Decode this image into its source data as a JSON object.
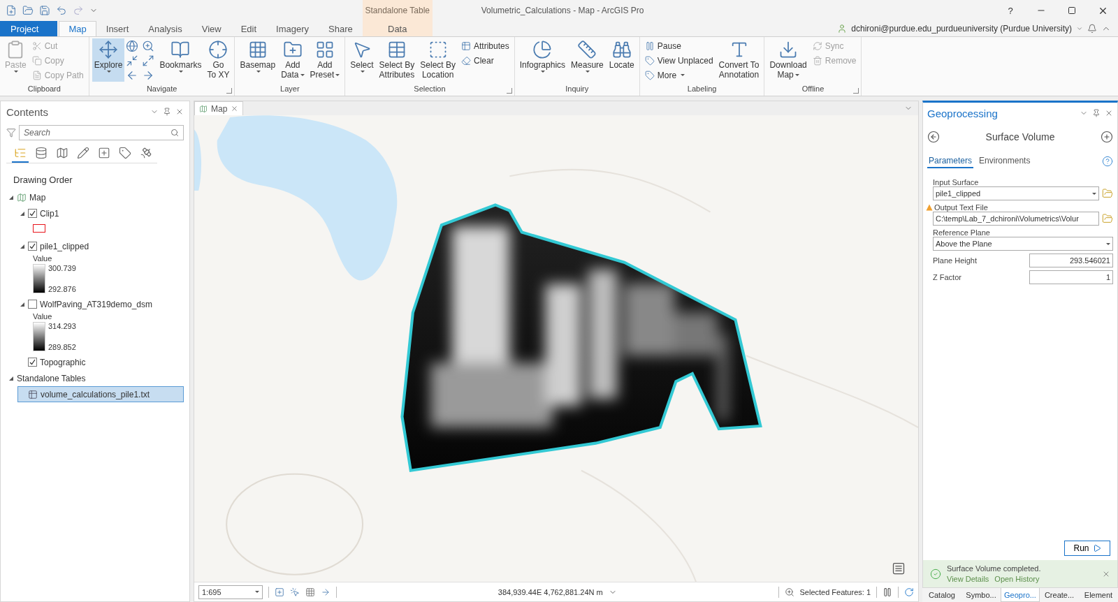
{
  "window": {
    "title": "Volumetric_Calculations - Map - ArcGIS Pro",
    "help": "?"
  },
  "contextual_tab_group": {
    "label": "Standalone Table",
    "tabs": [
      {
        "label": "Data",
        "selected": false
      }
    ]
  },
  "tabs": [
    {
      "label": "Project",
      "kind": "backstage",
      "selected": false
    },
    {
      "label": "Map",
      "kind": "tab",
      "selected": true
    },
    {
      "label": "Insert",
      "kind": "tab",
      "selected": false
    },
    {
      "label": "Analysis",
      "kind": "tab",
      "selected": false
    },
    {
      "label": "View",
      "kind": "tab",
      "selected": false
    },
    {
      "label": "Edit",
      "kind": "tab",
      "selected": false
    },
    {
      "label": "Imagery",
      "kind": "tab",
      "selected": false
    },
    {
      "label": "Share",
      "kind": "tab",
      "selected": false
    }
  ],
  "user": {
    "name": "dchironi@purdue.edu_purdueuniversity (Purdue University)"
  },
  "ribbon": {
    "groups": [
      {
        "label": "Clipboard",
        "launcher": false,
        "buttons": [
          {
            "kind": "large",
            "lines": [
              "Paste"
            ],
            "dropdown": true,
            "disabled": true,
            "selected": false
          },
          {
            "kind": "small",
            "lines": [
              "Cut"
            ],
            "dropdown": false,
            "disabled": true,
            "selected": false
          },
          {
            "kind": "small",
            "lines": [
              "Copy"
            ],
            "dropdown": false,
            "disabled": true,
            "selected": false
          },
          {
            "kind": "small",
            "lines": [
              "Copy Path"
            ],
            "dropdown": false,
            "disabled": true,
            "selected": false
          }
        ]
      },
      {
        "label": "Navigate",
        "launcher": true,
        "buttons": [
          {
            "kind": "large",
            "lines": [
              "Explore"
            ],
            "dropdown": true,
            "disabled": false,
            "selected": true
          },
          {
            "kind": "icon-grid"
          },
          {
            "kind": "large",
            "lines": [
              "Bookmarks"
            ],
            "dropdown": true,
            "disabled": false,
            "selected": false
          },
          {
            "kind": "large",
            "lines": [
              "Go",
              "To XY"
            ],
            "dropdown": false,
            "disabled": false,
            "selected": false
          }
        ]
      },
      {
        "label": "Layer",
        "launcher": false,
        "buttons": [
          {
            "kind": "large",
            "lines": [
              "Basemap"
            ],
            "dropdown": true,
            "disabled": false,
            "selected": false
          },
          {
            "kind": "large",
            "lines": [
              "Add",
              "Data"
            ],
            "dropdown": true,
            "disabled": false,
            "selected": false
          },
          {
            "kind": "large",
            "lines": [
              "Add",
              "Preset"
            ],
            "dropdown": true,
            "disabled": false,
            "selected": false
          }
        ]
      },
      {
        "label": "Selection",
        "launcher": true,
        "buttons": [
          {
            "kind": "large",
            "lines": [
              "Select"
            ],
            "dropdown": true,
            "disabled": false,
            "selected": false
          },
          {
            "kind": "large",
            "lines": [
              "Select By",
              "Attributes"
            ],
            "dropdown": false,
            "disabled": false,
            "selected": false
          },
          {
            "kind": "large",
            "lines": [
              "Select By",
              "Location"
            ],
            "dropdown": false,
            "disabled": false,
            "selected": false
          },
          {
            "kind": "small",
            "lines": [
              "Attributes"
            ],
            "dropdown": false,
            "disabled": false,
            "selected": false
          },
          {
            "kind": "small",
            "lines": [
              "Clear"
            ],
            "dropdown": false,
            "disabled": false,
            "selected": false
          }
        ]
      },
      {
        "label": "Inquiry",
        "launcher": false,
        "buttons": [
          {
            "kind": "large",
            "lines": [
              "Infographics"
            ],
            "dropdown": true,
            "disabled": false,
            "selected": false
          },
          {
            "kind": "large",
            "lines": [
              "Measure"
            ],
            "dropdown": true,
            "disabled": false,
            "selected": false
          },
          {
            "kind": "large",
            "lines": [
              "Locate"
            ],
            "dropdown": false,
            "disabled": false,
            "selected": false
          }
        ]
      },
      {
        "label": "Labeling",
        "launcher": false,
        "buttons": [
          {
            "kind": "small",
            "lines": [
              "Pause"
            ],
            "dropdown": false,
            "disabled": false,
            "selected": false
          },
          {
            "kind": "small",
            "lines": [
              "View Unplaced"
            ],
            "dropdown": false,
            "disabled": false,
            "selected": false
          },
          {
            "kind": "small",
            "lines": [
              "More"
            ],
            "dropdown": true,
            "disabled": false,
            "selected": false
          },
          {
            "kind": "large",
            "lines": [
              "Convert To",
              "Annotation"
            ],
            "dropdown": false,
            "disabled": false,
            "selected": false
          }
        ]
      },
      {
        "label": "Offline",
        "launcher": true,
        "buttons": [
          {
            "kind": "large",
            "lines": [
              "Download",
              "Map"
            ],
            "dropdown": true,
            "disabled": false,
            "selected": false
          },
          {
            "kind": "small",
            "lines": [
              "Sync"
            ],
            "dropdown": false,
            "disabled": true,
            "selected": false
          },
          {
            "kind": "small",
            "lines": [
              "Remove"
            ],
            "dropdown": false,
            "disabled": true,
            "selected": false
          }
        ]
      }
    ]
  },
  "contents": {
    "title": "Contents",
    "search": {
      "placeholder": "Search"
    },
    "views": [
      {
        "selected": true
      },
      {
        "selected": false
      },
      {
        "selected": false
      },
      {
        "selected": false
      },
      {
        "selected": false
      },
      {
        "selected": false
      },
      {
        "selected": false
      }
    ],
    "heading": "Drawing Order",
    "tree": [
      {
        "kind": "map",
        "label": "Map",
        "expanded": true,
        "selected": false,
        "children": [
          {
            "kind": "layer",
            "label": "Clip1",
            "checked": true,
            "expanded": true,
            "selected": false,
            "legend": {
              "kind": "outline"
            }
          },
          {
            "kind": "layer",
            "label": "pile1_clipped",
            "checked": true,
            "expanded": true,
            "selected": false,
            "legend": {
              "kind": "stretch",
              "title": "Value",
              "high": "300.739",
              "low": "292.876"
            }
          },
          {
            "kind": "layer",
            "label": "WolfPaving_AT319demo_dsm",
            "checked": false,
            "expanded": true,
            "selected": false,
            "legend": {
              "kind": "stretch",
              "title": "Value",
              "high": "314.293",
              "low": "289.852"
            }
          },
          {
            "kind": "basemap",
            "label": "Topographic",
            "checked": true,
            "selected": false
          }
        ]
      },
      {
        "kind": "group",
        "label": "Standalone Tables",
        "expanded": true,
        "selected": false,
        "children": [
          {
            "kind": "table",
            "label": "volume_calculations_pile1.txt",
            "selected": true
          }
        ]
      }
    ]
  },
  "map_view": {
    "tab": "Map",
    "scale": "1:695",
    "coordinates": "384,939.44E 4,762,881.24N m",
    "selected_features": "Selected Features: 1"
  },
  "geoprocessing": {
    "title": "Geoprocessing",
    "tool": "Surface Volume",
    "tabs": [
      {
        "label": "Parameters",
        "selected": true
      },
      {
        "label": "Environments",
        "selected": false
      }
    ],
    "parameters": [
      {
        "kind": "select",
        "label": "Input Surface",
        "value": "pile1_clipped",
        "browse": true,
        "warning": false
      },
      {
        "kind": "text",
        "label": "Output Text File",
        "value": "C:\\temp\\Lab_7_dchironi\\Volumetrics\\Volur",
        "browse": true,
        "warning": true
      },
      {
        "kind": "select",
        "label": "Reference Plane",
        "value": "Above the Plane",
        "browse": false,
        "warning": false
      },
      {
        "kind": "inline",
        "label": "Plane Height",
        "value": "293.546021"
      },
      {
        "kind": "inline",
        "label": "Z Factor",
        "value": "1"
      }
    ],
    "run": "Run",
    "message": {
      "kind": "success",
      "text": "Surface Volume completed.",
      "links": [
        "View Details",
        "Open History"
      ]
    }
  },
  "dock_tabs": [
    {
      "label": "Catalog",
      "selected": false
    },
    {
      "label": "Symbo...",
      "selected": false
    },
    {
      "label": "Geopro...",
      "selected": true
    },
    {
      "label": "Create...",
      "selected": false
    },
    {
      "label": "Element",
      "selected": false
    }
  ]
}
